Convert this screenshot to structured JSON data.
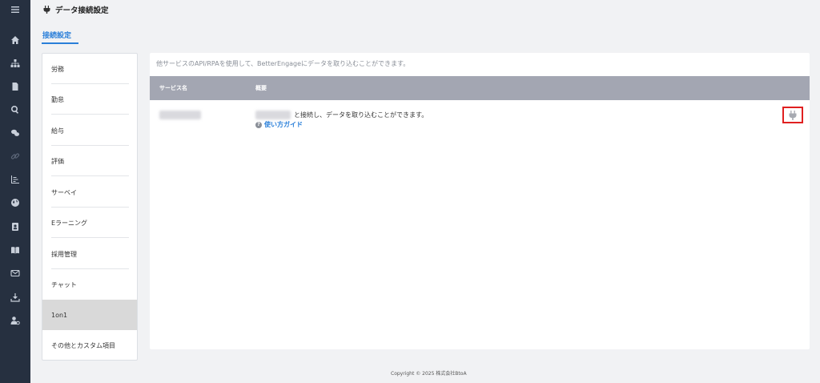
{
  "header": {
    "title": "データ接続設定",
    "tab": "接続設定"
  },
  "menu": {
    "items": [
      {
        "label": "労務"
      },
      {
        "label": "勤怠"
      },
      {
        "label": "給与"
      },
      {
        "label": "評価"
      },
      {
        "label": "サーベイ"
      },
      {
        "label": "Eラーニング"
      },
      {
        "label": "採用管理"
      },
      {
        "label": "チャット"
      },
      {
        "label": "1on1"
      },
      {
        "label": "その他とカスタム項目"
      }
    ],
    "active": "1on1"
  },
  "main": {
    "description": "他サービスのAPI/RPAを使用して、BetterEngageにデータを取り込むことができます。",
    "columns": {
      "service": "サービス名",
      "summary": "概要"
    },
    "row": {
      "summary": "と接続し、データを取り込むことができます。",
      "guide": "使い方ガイド"
    }
  },
  "footer": {
    "copyright": "Copyright © 2025 株式会社BtoA"
  },
  "icons": {
    "rail": [
      "menu-icon",
      "home-icon",
      "org-chart-icon",
      "document-icon",
      "search-icon",
      "chat-icon",
      "link-icon",
      "chart-icon",
      "globe-icon",
      "contact-icon",
      "book-icon",
      "mail-icon",
      "download-icon",
      "user-settings-icon"
    ],
    "title": "plug-icon",
    "connect": "plug-icon"
  },
  "colors": {
    "accent": "#2a7fd9",
    "rail": "#263040",
    "table_header": "#a3a6b2",
    "highlight": "#e02020"
  }
}
